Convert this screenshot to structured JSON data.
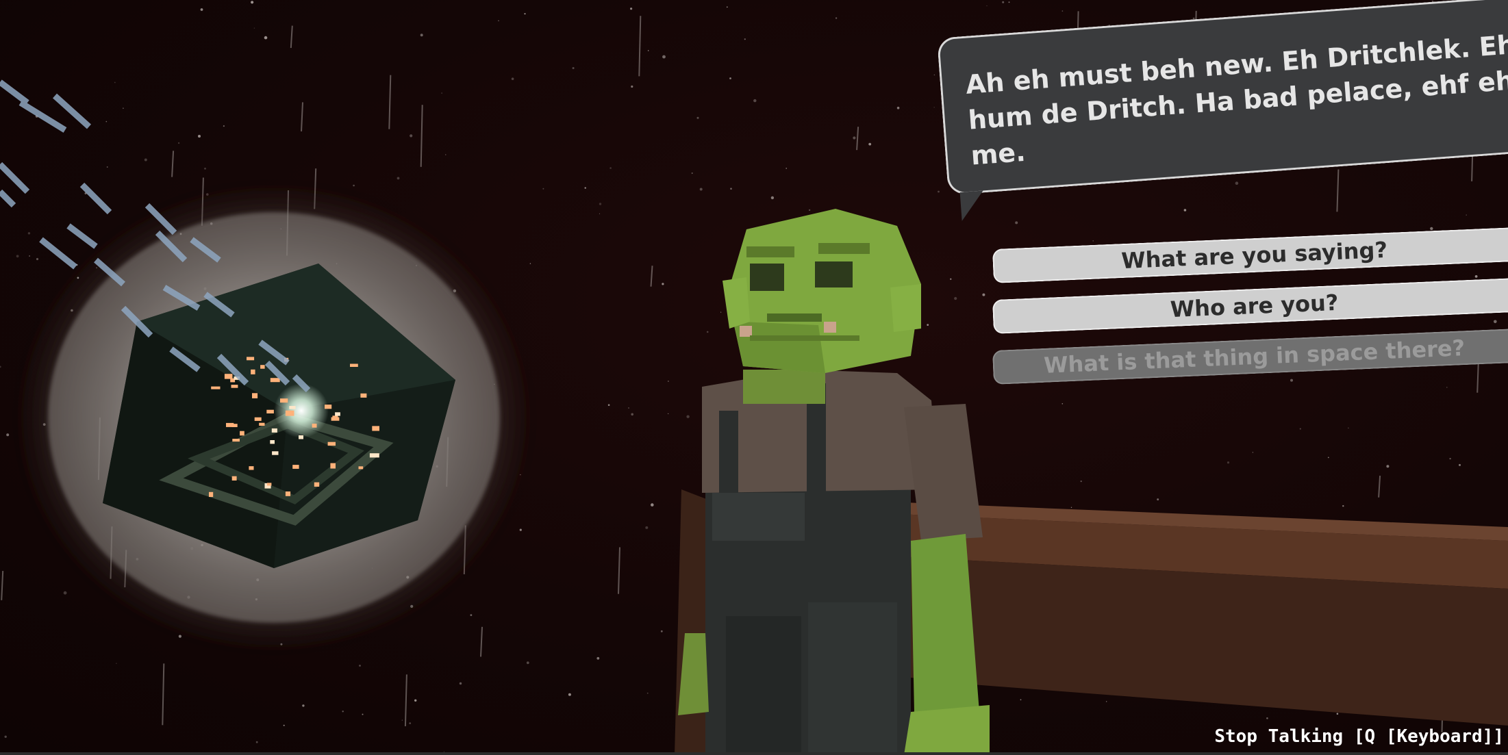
{
  "dialogue": {
    "npc_line": "Ah eh must beh new. Eh Dritchlek. Eh\nhum de Dritch. Ha bad pelace, ehf eh\nme.",
    "options": [
      {
        "label": "What are you saying?",
        "state": "available"
      },
      {
        "label": "Who are you?",
        "state": "available"
      },
      {
        "label": "What is that thing in space there?",
        "state": "dimmed"
      }
    ]
  },
  "hint": {
    "text": "Stop Talking [Q [Keyboard]]"
  },
  "colors": {
    "space_background": "#140606",
    "bubble_fill": "#3a3b3d",
    "bubble_text": "#e6e6e6",
    "option_fill": "#cfcfcf",
    "option_dim_fill": "#707070",
    "npc_skin": "#7fa83f",
    "npc_shirt": "#5e5048",
    "npc_overalls": "#2b2e2d",
    "railing": "#4a2e20",
    "portal_glow": "#ffb27a"
  }
}
